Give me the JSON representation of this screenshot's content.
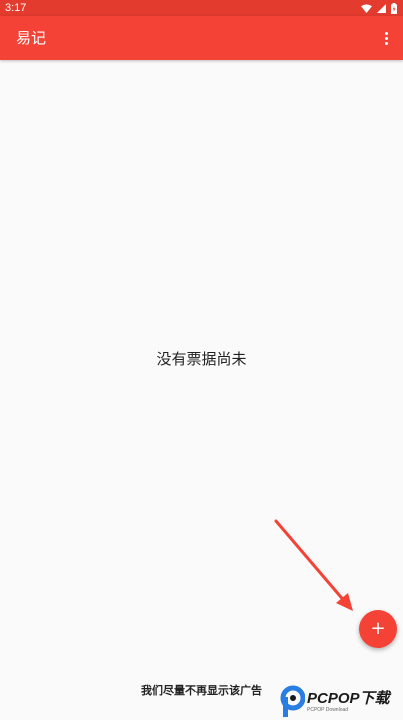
{
  "status_bar": {
    "time": "3:17"
  },
  "app_bar": {
    "title": "易记",
    "menu_icon": "more-vert-icon"
  },
  "main": {
    "empty_message": "没有票据尚未"
  },
  "fab": {
    "label": "+",
    "icon": "plus-icon"
  },
  "footer": {
    "ad_text": "我们尽量不再显示该广告"
  },
  "watermark": {
    "brand": "PCPOP下载",
    "subtitle": "PCPOP Download"
  },
  "colors": {
    "primary": "#f44336",
    "status_bar": "#e33b2e",
    "background": "#fafafa"
  }
}
